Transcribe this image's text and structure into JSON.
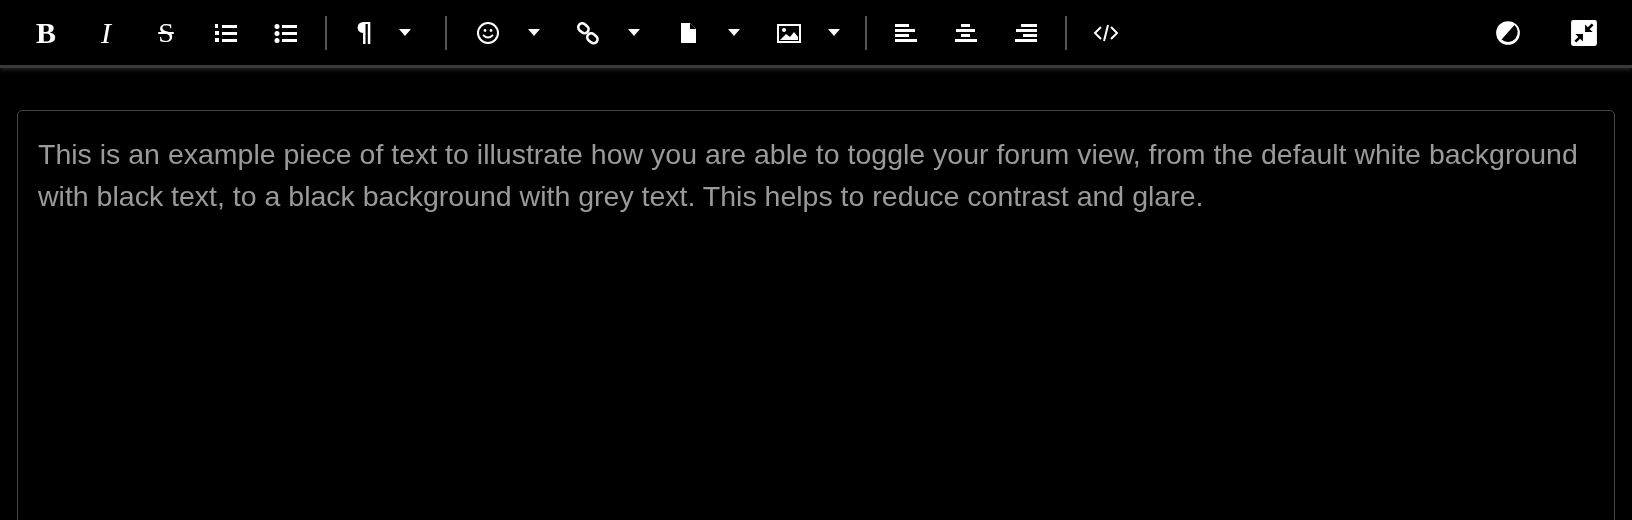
{
  "toolbar": {
    "groups": [
      [
        {
          "kind": "bold",
          "glyph": "B"
        },
        {
          "kind": "italic",
          "glyph": "I"
        },
        {
          "kind": "strike",
          "glyph": "S"
        },
        {
          "kind": "ordered-list"
        },
        {
          "kind": "bullet-list"
        }
      ],
      [
        {
          "kind": "paragraph",
          "glyph": "¶",
          "dropdown": true
        }
      ],
      [
        {
          "kind": "smiley",
          "dropdown": true
        },
        {
          "kind": "link",
          "dropdown": true
        },
        {
          "kind": "file",
          "dropdown": true
        },
        {
          "kind": "image",
          "dropdown": true
        }
      ],
      [
        {
          "kind": "align-left"
        },
        {
          "kind": "align-center"
        },
        {
          "kind": "align-right"
        }
      ],
      [
        {
          "kind": "code"
        }
      ]
    ],
    "right": [
      {
        "kind": "contrast"
      },
      {
        "kind": "collapse"
      }
    ]
  },
  "editor": {
    "text": "This is an example piece of text to illustrate how you are able to toggle your forum view, from the default white background with black text, to a black background with grey text. This helps to reduce contrast and glare."
  }
}
